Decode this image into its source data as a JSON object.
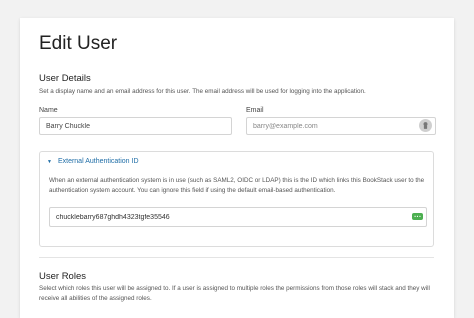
{
  "page": {
    "title": "Edit User"
  },
  "user_details": {
    "title": "User Details",
    "description": "Set a display name and an email address for this user. The email address will be used for logging into the application.",
    "name_label": "Name",
    "name_value": "Barry Chuckle",
    "email_label": "Email",
    "email_placeholder": "barry@example.com"
  },
  "external_auth": {
    "caret": "▼",
    "title": "External Authentication ID",
    "description": "When an external authentication system is in use (such as SAML2, OIDC or LDAP) this is the ID which links this BookStack user to the authentication system account. You can ignore this field if using the default email-based authentication.",
    "value": "chucklebarry687ghdh4323tgfe35546",
    "badge": "•••"
  },
  "user_roles": {
    "title": "User Roles",
    "description": "Select which roles this user will be assigned to. If a user is assigned to multiple roles the permissions from those roles will stack and they will receive all abilities of the assigned roles."
  },
  "icons": {
    "password_manager": "password-manager-icon",
    "autofill_badge": "autofill-badge-icon"
  }
}
